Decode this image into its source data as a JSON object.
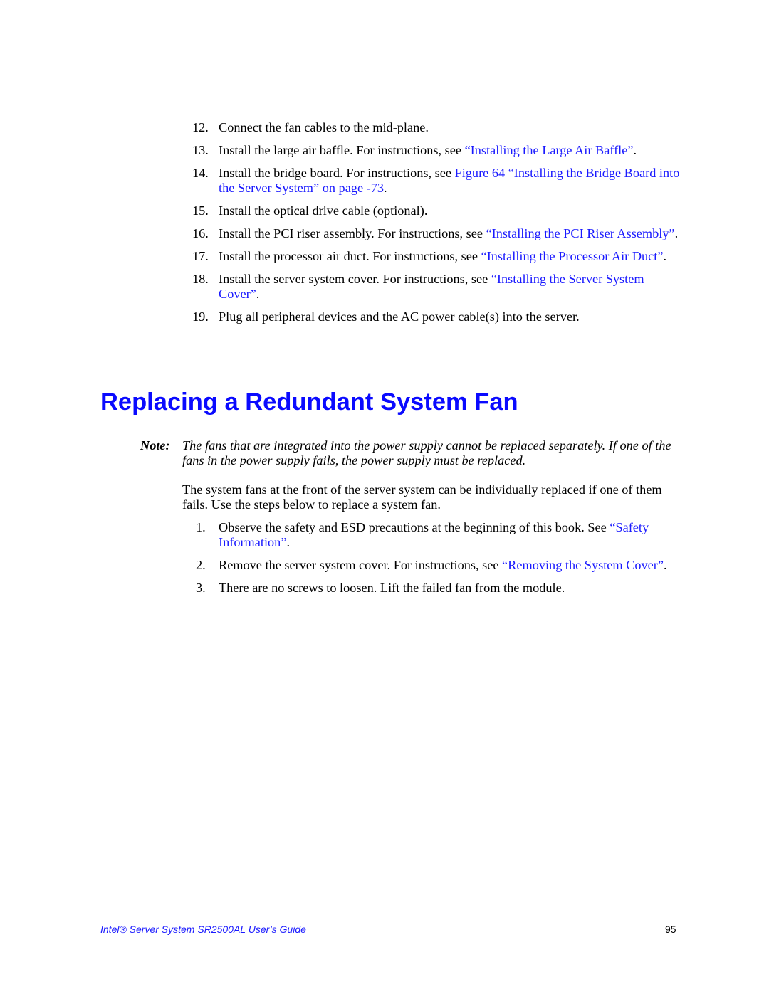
{
  "steps_continued": [
    {
      "number": "12.",
      "text": "Connect the fan cables to the mid-plane.",
      "link": "",
      "suffix": ""
    },
    {
      "number": "13.",
      "text": "Install the large air baffle. For instructions, see ",
      "link": "“Installing the Large Air Baffle”",
      "suffix": "."
    },
    {
      "number": "14.",
      "text": "Install the bridge board. For instructions, see ",
      "link": "Figure 64 “Installing the Bridge Board into the Server System” on page -73",
      "suffix": "."
    },
    {
      "number": "15.",
      "text": "Install the optical drive cable (optional).",
      "link": "",
      "suffix": ""
    },
    {
      "number": "16.",
      "text": "Install the PCI riser assembly. For instructions, see ",
      "link": "“Installing the PCI Riser Assembly”",
      "suffix": "."
    },
    {
      "number": "17.",
      "text": "Install the processor air duct. For instructions, see ",
      "link": "“Installing the Processor Air Duct”",
      "suffix": "."
    },
    {
      "number": "18.",
      "text": "Install the server system cover. For instructions, see ",
      "link": "“Installing the Server System Cover”",
      "suffix": "."
    },
    {
      "number": "19.",
      "text": "Plug all peripheral devices and the AC power cable(s) into the server.",
      "link": "",
      "suffix": ""
    }
  ],
  "section": {
    "heading": "Replacing a Redundant System Fan",
    "note_label": "Note:",
    "note_text": "The fans that are integrated into the power supply cannot be replaced separately. If one of the fans in the power supply fails, the power supply must be replaced.",
    "intro": "The system fans at the front of the server system can be individually replaced if one of them fails. Use the steps below to replace a system fan.",
    "steps": [
      {
        "number": "1.",
        "text": "Observe the safety and ESD precautions at the beginning of this book. See ",
        "link": "“Safety Information”",
        "suffix": "."
      },
      {
        "number": "2.",
        "text": "Remove the server system cover. For instructions, see ",
        "link": "“Removing the System Cover”",
        "suffix": "."
      },
      {
        "number": "3.",
        "text": "There are no screws to loosen. Lift the failed fan from the module.",
        "link": "",
        "suffix": ""
      }
    ]
  },
  "footer": {
    "title": "Intel® Server System SR2500AL User’s Guide",
    "page_number": "95"
  },
  "colors": {
    "link": "#1a1aff",
    "heading": "#0a0aff",
    "text": "#000000"
  }
}
